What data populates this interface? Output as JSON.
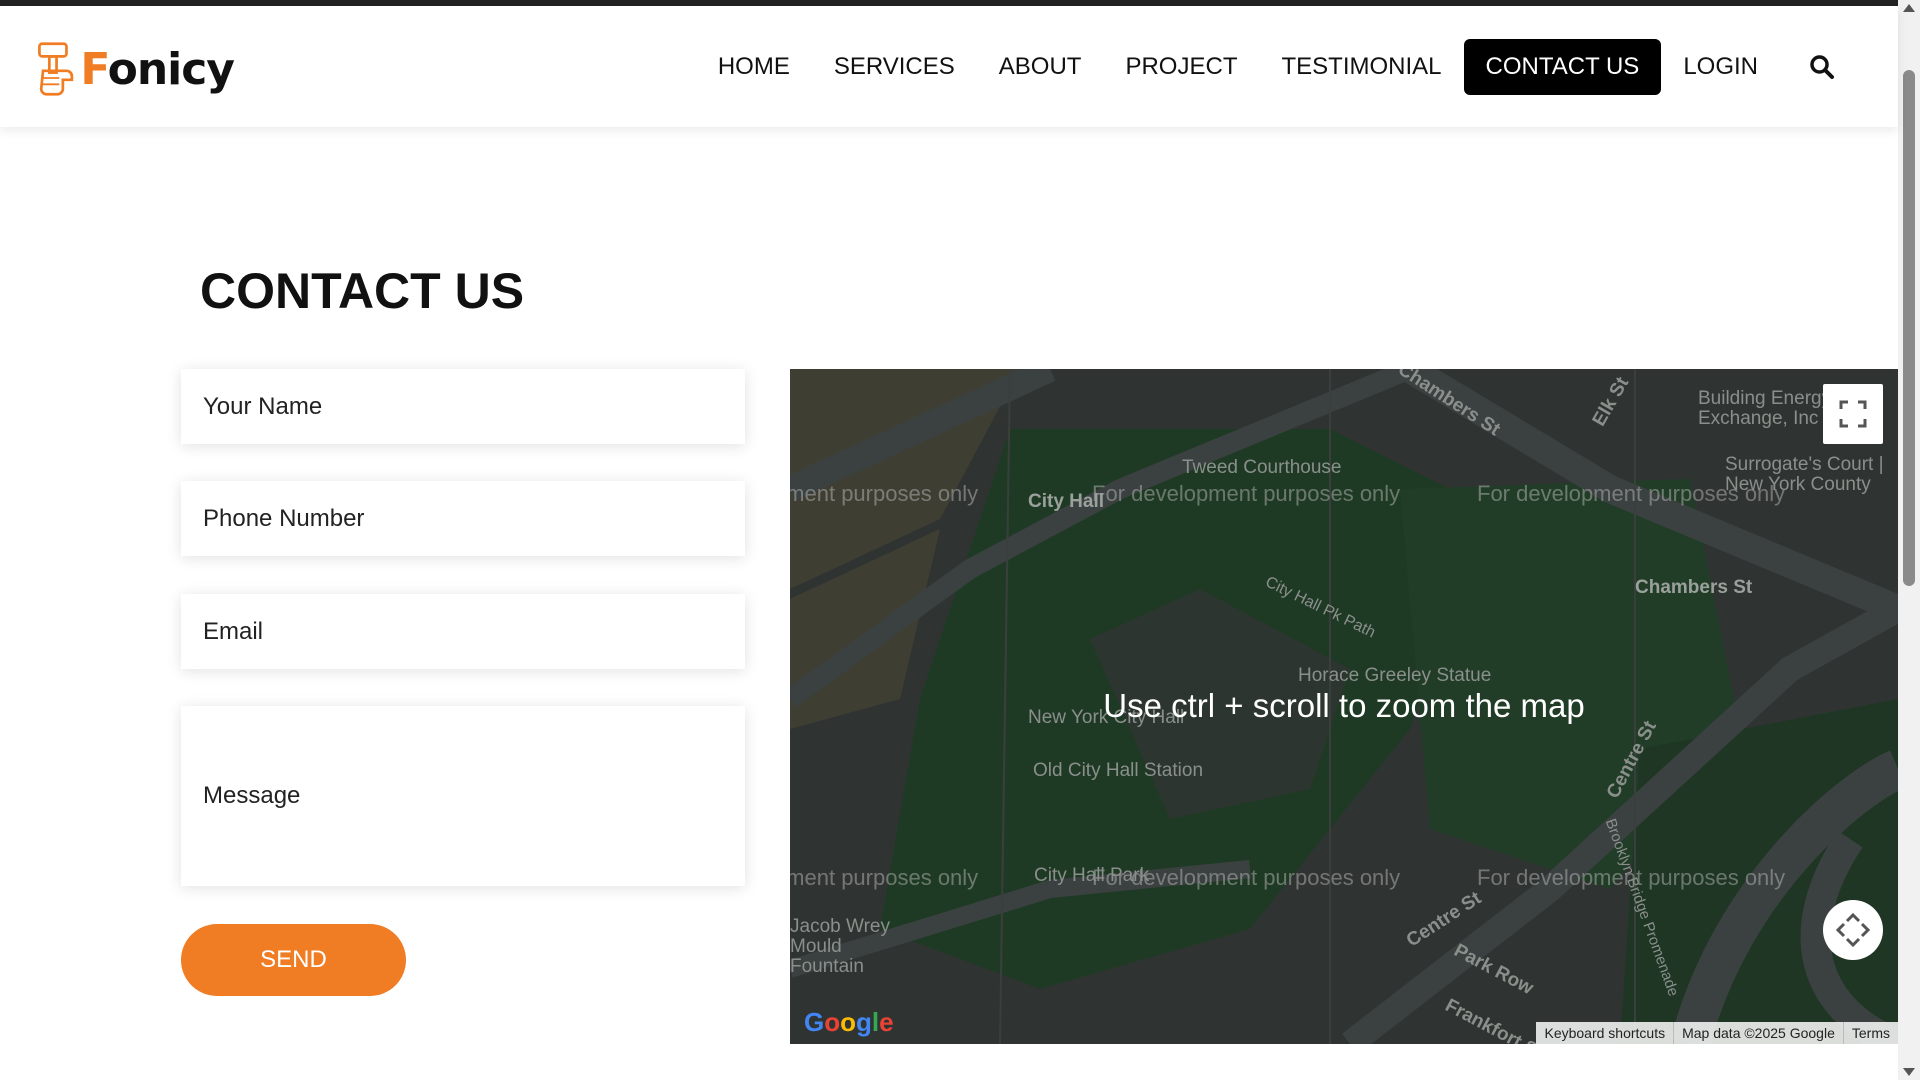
{
  "brand": {
    "name_first": "F",
    "name_rest": "onicy",
    "accent": "#f07c24"
  },
  "nav": {
    "items": [
      {
        "label": "HOME",
        "active": false
      },
      {
        "label": "SERVICES",
        "active": false
      },
      {
        "label": "ABOUT",
        "active": false
      },
      {
        "label": "PROJECT",
        "active": false
      },
      {
        "label": "TESTIMONIAL",
        "active": false
      },
      {
        "label": "CONTACT US",
        "active": true
      },
      {
        "label": "LOGIN",
        "active": false
      }
    ],
    "search_icon": "search-icon"
  },
  "contact": {
    "title": "CONTACT US",
    "name_placeholder": "Your Name",
    "phone_placeholder": "Phone Number",
    "email_placeholder": "Email",
    "message_placeholder": "Message",
    "send_label": "SEND"
  },
  "map": {
    "overlay_message": "Use ctrl + scroll to zoom the map",
    "dev_watermark": "For development purposes only",
    "places": {
      "tweed": "Tweed Courthouse",
      "city_hall": "City Hall",
      "chambers": "Chambers St",
      "chambers_street": "Chambers St",
      "horace": "Horace Greeley Statue",
      "nyc_hall": "New York City Hall",
      "old_station": "Old City Hall Station",
      "city_hall_park": "City Hall Park",
      "jacob": "Jacob Wrey Mould Fountain",
      "building": "Building Energy Exchange, Inc",
      "surrogate": "Surrogate's Court | New York County",
      "centre": "Centre St",
      "centre2": "Centre St",
      "park_row": "Park Row",
      "elk": "Elk St",
      "pk_path": "City Hall Pk Path",
      "brooklyn": "Brooklyn Bridge Promenade",
      "frankfort": "Frankfort St"
    },
    "footer": {
      "shortcuts": "Keyboard shortcuts",
      "data": "Map data ©2025 Google",
      "terms": "Terms"
    },
    "logo": "Google"
  }
}
